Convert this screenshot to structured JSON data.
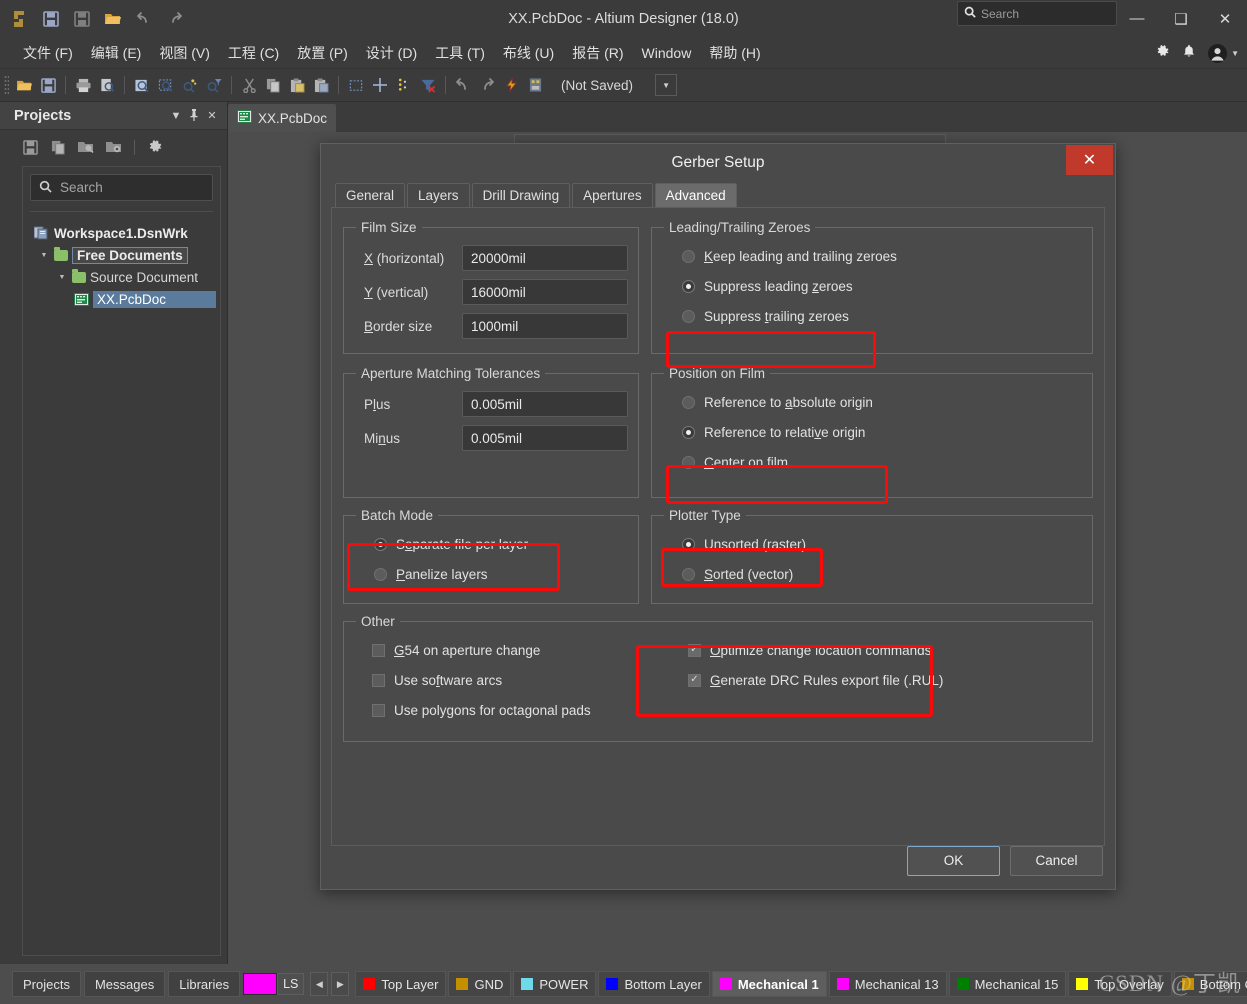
{
  "window": {
    "title": "XX.PcbDoc - Altium Designer (18.0)",
    "search_placeholder": "Search",
    "minimize": "—",
    "maximize": "❑",
    "close": "✕"
  },
  "menubar": {
    "items": [
      {
        "label": "文件 (F)",
        "key": "F"
      },
      {
        "label": "编辑 (E)",
        "key": "E"
      },
      {
        "label": "视图 (V)",
        "key": "V"
      },
      {
        "label": "工程 (C)",
        "key": "C"
      },
      {
        "label": "放置 (P)",
        "key": "P"
      },
      {
        "label": "设计 (D)",
        "key": "D"
      },
      {
        "label": "工具 (T)",
        "key": "T"
      },
      {
        "label": "布线 (U)",
        "key": "U"
      },
      {
        "label": "报告 (R)",
        "key": "R"
      },
      {
        "label": "Window",
        "key": "W"
      },
      {
        "label": "帮助 (H)",
        "key": "H"
      }
    ]
  },
  "toolbar": {
    "not_saved": "(Not Saved)"
  },
  "projects_panel": {
    "title": "Projects",
    "search_placeholder": "Search",
    "tree": {
      "workspace": "Workspace1.DsnWrk",
      "free_documents": "Free Documents",
      "source_document": "Source Document",
      "document": "XX.PcbDoc"
    }
  },
  "document_tab": {
    "label": "XX.PcbDoc"
  },
  "dialog": {
    "title": "Gerber Setup",
    "close_label": "✕",
    "tabs": [
      {
        "label": "General",
        "active": false
      },
      {
        "label": "Layers",
        "active": false
      },
      {
        "label": "Drill Drawing",
        "active": false
      },
      {
        "label": "Apertures",
        "active": false
      },
      {
        "label": "Advanced",
        "active": true
      }
    ],
    "film_size": {
      "legend": "Film Size",
      "fields": [
        {
          "label": "X (horizontal)",
          "accel": "X",
          "value": "20000mil"
        },
        {
          "label": "Y (vertical)",
          "accel": "Y",
          "value": "16000mil"
        },
        {
          "label": "Border size",
          "accel": "B",
          "value": "1000mil"
        }
      ]
    },
    "zeroes": {
      "legend": "Leading/Trailing Zeroes",
      "options": [
        {
          "label": "Keep leading and trailing zeroes",
          "selected": false
        },
        {
          "label": "Suppress leading zeroes",
          "selected": true
        },
        {
          "label": "Suppress trailing zeroes",
          "selected": false
        }
      ]
    },
    "aperture_tolerances": {
      "legend": "Aperture Matching Tolerances",
      "fields": [
        {
          "label": "Plus",
          "value": "0.005mil"
        },
        {
          "label": "Minus",
          "value": "0.005mil"
        }
      ]
    },
    "position_on_film": {
      "legend": "Position on Film",
      "options": [
        {
          "label": "Reference to absolute origin",
          "selected": false
        },
        {
          "label": "Reference to relative origin",
          "selected": true
        },
        {
          "label": "Center on film",
          "selected": false
        }
      ]
    },
    "batch_mode": {
      "legend": "Batch Mode",
      "options": [
        {
          "label": "Separate file per layer",
          "selected": true
        },
        {
          "label": "Panelize layers",
          "selected": false
        }
      ]
    },
    "plotter_type": {
      "legend": "Plotter Type",
      "options": [
        {
          "label": "Unsorted (raster)",
          "selected": true
        },
        {
          "label": "Sorted (vector)",
          "selected": false
        }
      ]
    },
    "other": {
      "legend": "Other",
      "left_checks": [
        {
          "label": "G54 on aperture change",
          "checked": false
        },
        {
          "label": "Use software arcs",
          "checked": false
        },
        {
          "label": "Use polygons for octagonal pads",
          "checked": false
        }
      ],
      "right_checks": [
        {
          "label": "Optimize change location commands",
          "checked": true
        },
        {
          "label": "Generate DRC Rules export file (.RUL)",
          "checked": true
        }
      ]
    },
    "buttons": {
      "ok": "OK",
      "cancel": "Cancel"
    },
    "highlight_color": "#fb0a0a"
  },
  "statusbar": {
    "panel_tabs": [
      "Projects",
      "Messages",
      "Libraries"
    ],
    "active_swatch_color": "#ff00ff",
    "ls_label": "LS",
    "prev_arrow": "◀",
    "next_arrow": "▶",
    "layers": [
      {
        "label": "Top Layer",
        "color": "#ff0000",
        "active": false
      },
      {
        "label": "GND",
        "color": "#c49000",
        "active": false
      },
      {
        "label": "POWER",
        "color": "#6fd8ea",
        "active": false
      },
      {
        "label": "Bottom Layer",
        "color": "#0000ff",
        "active": false
      },
      {
        "label": "Mechanical 1",
        "color": "#ff00ff",
        "active": true
      },
      {
        "label": "Mechanical 13",
        "color": "#ff00ff",
        "active": false
      },
      {
        "label": "Mechanical 15",
        "color": "#008000",
        "active": false
      },
      {
        "label": "Top Overlay",
        "color": "#ffff00",
        "active": false
      },
      {
        "label": "Bottom Overl",
        "color": "#c49000",
        "active": false
      }
    ],
    "watermark": "CSDN @丁凯"
  }
}
